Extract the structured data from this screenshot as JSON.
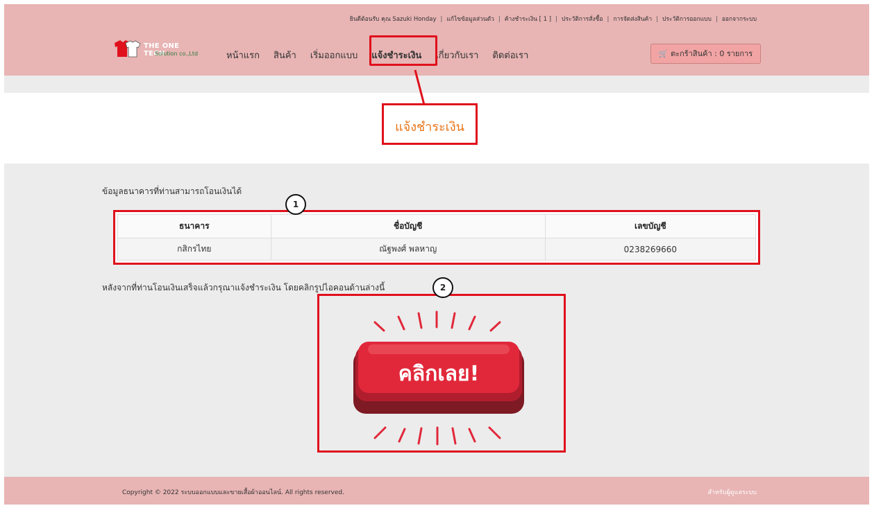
{
  "topbar": {
    "welcome": "ยินดีต้อนรับ คุณ Sazuki Honday",
    "links": [
      "แก้ไขข้อมูลส่วนตัว",
      "ค้างชำระเงิน [ 1 ]",
      "ประวัติการสั่งซื้อ",
      "การจัดส่งสินค้า",
      "ประวัติการออกแบบ",
      "ออกจากระบบ"
    ],
    "separator": "|"
  },
  "logo": {
    "line1": "THE ONE TECH",
    "line2": "Solution co.,Ltd"
  },
  "nav": {
    "items": [
      "หน้าแรก",
      "สินค้า",
      "เริ่มออกแบบ",
      "แจ้งชำระเงิน",
      "เกี่ยวกับเรา",
      "ติดต่อเรา"
    ]
  },
  "cart": {
    "icon": "cart-icon",
    "label": "ตะกร้าสินค้า : 0 รายการ"
  },
  "page": {
    "title": "แจ้งชำระเงิน"
  },
  "bank_section": {
    "label": "ข้อมูลธนาคารที่ท่านสามารถโอนเงินได้",
    "headers": [
      "ธนาคาร",
      "ชื่อบัญชี",
      "เลขบัญชี"
    ],
    "row": [
      "กสิกรไทย",
      "ณัฐพงศ์ พลหาญ",
      "0238269660"
    ]
  },
  "after_transfer": {
    "label": "หลังจากที่ท่านโอนเงินเสร็จแล้วกรุณาแจ้งชำระเงิน โดยคลิกรูปไอคอนด้านล่างนี้"
  },
  "click_button": {
    "label": "คลิกเลย!"
  },
  "annotations": {
    "one": "1",
    "two": "2"
  },
  "footer": {
    "copyright": "Copyright © 2022 ระบบออกแบบและขายเสื้อผ้าออนไลน์. All rights reserved.",
    "admin_link": "สำหรับผู้ดูแลระบบ"
  },
  "colors": {
    "pink": "#e8b4b4",
    "highlight": "#e0101c",
    "title": "#e8761b",
    "button": "#e1283a"
  }
}
